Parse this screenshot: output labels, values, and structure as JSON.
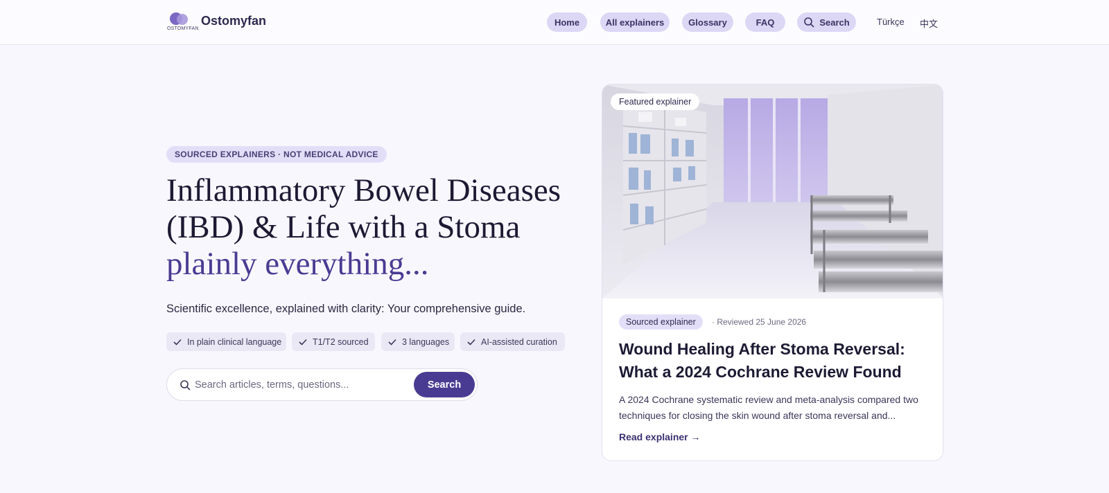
{
  "header": {
    "logo_text": "OSTOMYFAN",
    "brand": "Ostomyfan",
    "nav": [
      {
        "label": "Home"
      },
      {
        "label": "All explainers"
      },
      {
        "label": "Glossary"
      },
      {
        "label": "FAQ"
      },
      {
        "label": "Search",
        "icon": "search-icon"
      }
    ],
    "languages": [
      "Türkçe",
      "中文"
    ]
  },
  "hero": {
    "eyebrow": "SOURCED EXPLAINERS · NOT MEDICAL ADVICE",
    "headline_main": "Inflammatory Bowel Diseases (IBD) & Life with a Stoma",
    "headline_accent": "plainly everything...",
    "subtitle": "Scientific excellence, explained with clarity: Your comprehensive guide.",
    "chips": [
      {
        "label": "In plain clinical language",
        "icon": "check-icon"
      },
      {
        "label": "T1/T2 sourced",
        "icon": "check-icon"
      },
      {
        "label": "3 languages",
        "icon": "check-icon"
      },
      {
        "label": "AI-assisted curation",
        "icon": "check-icon"
      }
    ],
    "search": {
      "placeholder": "Search articles, terms, questions...",
      "value": "",
      "button_label": "Search"
    }
  },
  "featured": {
    "badge": "Featured explainer",
    "image": "hospital-corridor-with-shelves-and-steel-trolleys",
    "source_badge": "Sourced explainer",
    "reviewed": "· Reviewed 25 June 2026",
    "title": "Wound Healing After Stoma Reversal: What a 2024 Cochrane Review Found",
    "excerpt": "A 2024 Cochrane systematic review and meta-analysis compared two techniques for closing the skin wound after stoma reversal and...",
    "link_label": "Read explainer →"
  },
  "colors": {
    "accent": "#4a3b92",
    "pill_bg": "#dcd7f5",
    "page_bg": "#f9f7fe",
    "text": "#1c1a33"
  }
}
